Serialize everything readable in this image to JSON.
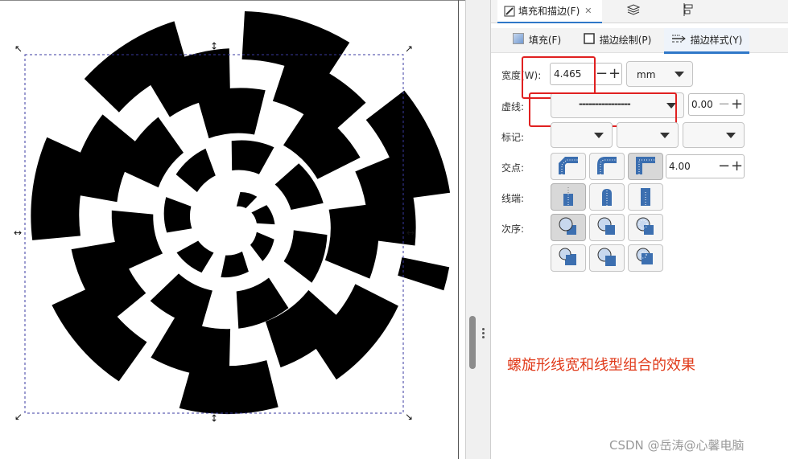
{
  "canvas": {
    "fill": "#000000",
    "selection_color": "#3a3aa0"
  },
  "panel": {
    "dock_tabs": [
      {
        "label": "填充和描边(F)",
        "icon": "fill-stroke-icon",
        "close": "✕"
      },
      {
        "label": "",
        "icon": "layers-icon"
      },
      {
        "label": "",
        "icon": "align-icon"
      }
    ],
    "sub_tabs": [
      {
        "label": "填充(F)",
        "icon": "fill-swatch-icon"
      },
      {
        "label": "描边绘制(P)",
        "icon": "stroke-paint-icon"
      },
      {
        "label": "描边样式(Y)",
        "icon": "stroke-style-icon"
      }
    ],
    "width": {
      "label": "宽度(W):",
      "value": "4.465",
      "unit": "mm"
    },
    "dashes": {
      "label": "虚线:",
      "pattern": "----------------",
      "offset": "0.00"
    },
    "markers": {
      "label": "标记:"
    },
    "join": {
      "label": "交点:",
      "miter_limit": "4.00"
    },
    "cap": {
      "label": "线端:"
    },
    "order": {
      "label": "次序:"
    },
    "minus": "−",
    "plus": "+",
    "annotation": "螺旋形线宽和线型组合的效果",
    "accent": "#2f78c8",
    "highlight": "#e02020"
  },
  "watermark": "CSDN @岳涛@心馨电脑"
}
